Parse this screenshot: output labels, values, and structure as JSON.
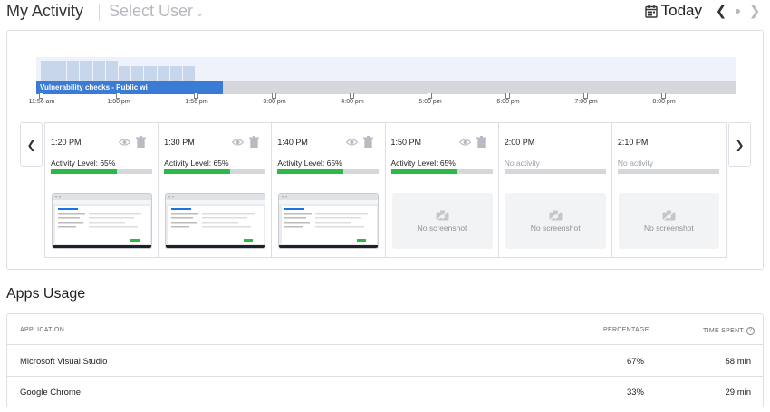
{
  "header": {
    "title": "My Activity",
    "user_select_label": "Select User",
    "date_label": "Today"
  },
  "timeline": {
    "task_label": "Vulnerability checks - Public wi",
    "ticks": [
      "11:56 am",
      "1:00 pm",
      "1:56 pm",
      "3:00 pm",
      "4:00 pm",
      "5:00 pm",
      "6:00 pm",
      "7:00 pm",
      "8:00 pm"
    ]
  },
  "slots": [
    {
      "time": "1:20 PM",
      "activity": "Activity Level: 65%",
      "level": 65,
      "has_screenshot": true
    },
    {
      "time": "1:30 PM",
      "activity": "Activity Level: 65%",
      "level": 65,
      "has_screenshot": true
    },
    {
      "time": "1:40 PM",
      "activity": "Activity Level: 65%",
      "level": 65,
      "has_screenshot": true
    },
    {
      "time": "1:50 PM",
      "activity": "Activity Level: 65%",
      "level": 65,
      "has_screenshot": false
    },
    {
      "time": "2:00 PM",
      "activity": "No activity",
      "level": 0,
      "has_screenshot": false
    },
    {
      "time": "2:10 PM",
      "activity": "No activity",
      "level": 0,
      "has_screenshot": false
    }
  ],
  "no_screenshot_label": "No screenshot",
  "apps_usage": {
    "title": "Apps Usage",
    "columns": {
      "application": "APPLICATION",
      "percentage": "PERCENTAGE",
      "time_spent": "TIME SPENT"
    },
    "rows": [
      {
        "app": "Microsoft Visual Studio",
        "percentage": "67%",
        "time": "58 min"
      },
      {
        "app": "Google Chrome",
        "percentage": "33%",
        "time": "29 min"
      }
    ]
  },
  "colors": {
    "accent": "#3a7bd5",
    "activity_green": "#2db84b",
    "track_gray": "#d5d7da"
  }
}
